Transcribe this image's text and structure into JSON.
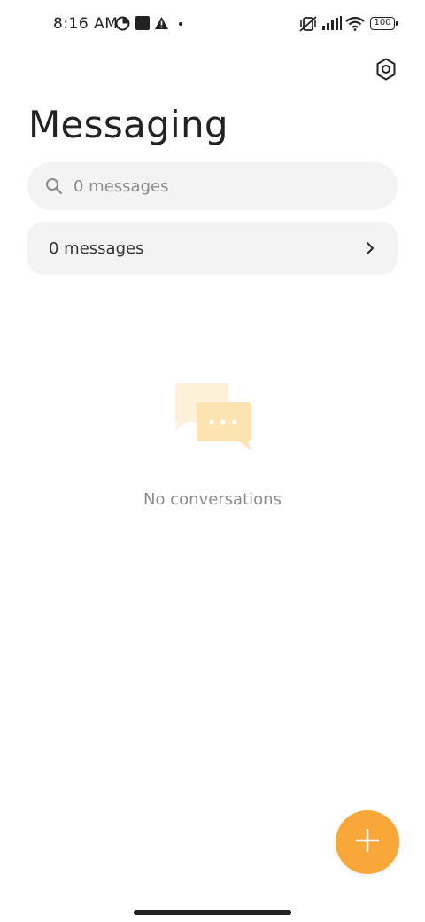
{
  "status_bar": {
    "time": "8:16 AM",
    "battery": "100",
    "icons": [
      "data-saver-icon",
      "square-notification-icon",
      "warning-icon",
      "dot-icon",
      "vibrate-off-icon",
      "signal-icon",
      "wifi-icon",
      "battery-icon"
    ]
  },
  "header": {
    "title": "Messaging",
    "settings_icon": "settings-hexagon-icon"
  },
  "search": {
    "placeholder": "0 messages"
  },
  "messages_row": {
    "label": "0 messages"
  },
  "empty_state": {
    "text": "No conversations",
    "illustration": "chat-bubbles-icon"
  },
  "fab": {
    "icon": "plus-icon",
    "color": "#f7a838"
  },
  "colors": {
    "accent": "#f7a838",
    "surface": "#f3f3f3",
    "secondary_text": "#8a8a8a"
  }
}
